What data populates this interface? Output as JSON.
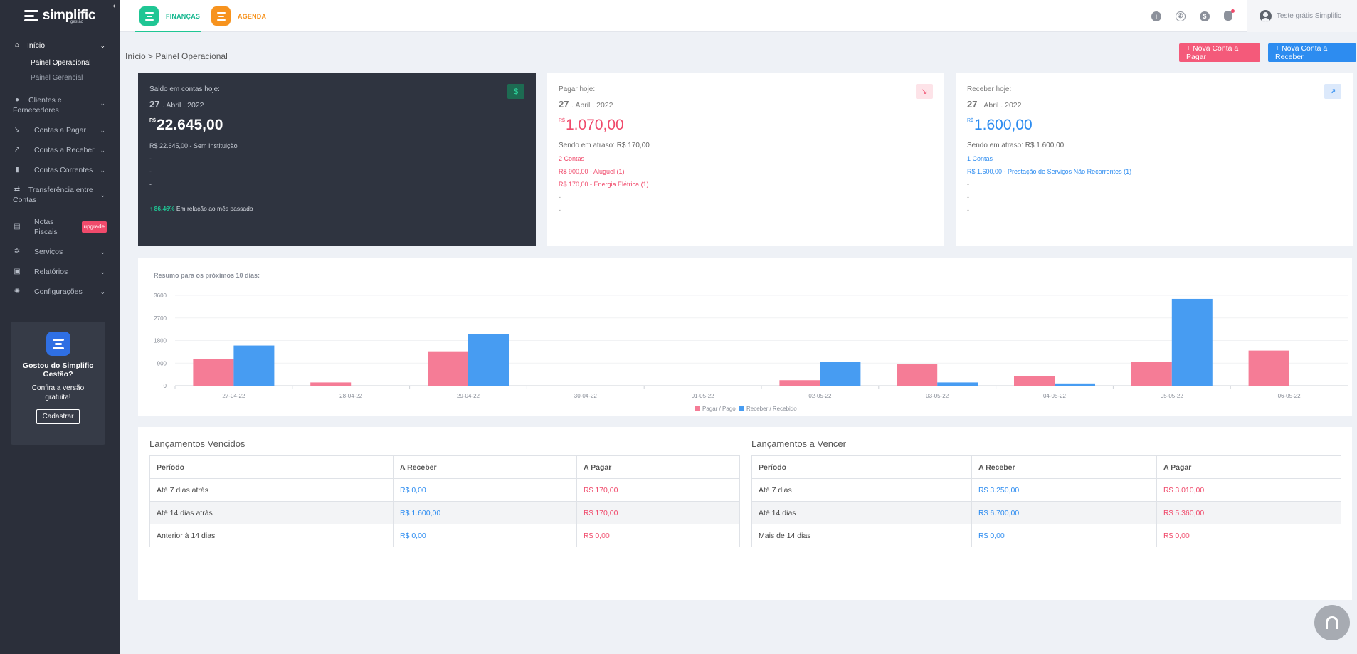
{
  "brand": {
    "name": "simplific",
    "sub": "gestão"
  },
  "sidebar": {
    "items": [
      {
        "label": "Início",
        "icon": "home-icon"
      },
      {
        "label": "Painel Operacional"
      },
      {
        "label": "Painel Gerencial"
      },
      {
        "label": "Clientes e Fornecedores",
        "icon": "users-icon"
      },
      {
        "label": "Contas a Pagar",
        "icon": "trend-down-icon"
      },
      {
        "label": "Contas a Receber",
        "icon": "trend-up-icon"
      },
      {
        "label": "Contas Correntes",
        "icon": "bar-chart-icon"
      },
      {
        "label": "Transferência entre Contas",
        "icon": "transfer-icon"
      },
      {
        "label": "Notas Fiscais",
        "icon": "document-icon",
        "badge": "upgrade"
      },
      {
        "label": "Serviços",
        "icon": "gear-icon"
      },
      {
        "label": "Relatórios",
        "icon": "report-icon"
      },
      {
        "label": "Configurações",
        "icon": "settings-icon"
      }
    ],
    "promo": {
      "title": "Gostou do Simplific Gestão?",
      "text": "Confira a versão gratuita!",
      "button": "Cadastrar"
    }
  },
  "topbar": {
    "modules": [
      {
        "label": "FINANÇAS",
        "color": "#1fc694"
      },
      {
        "label": "AGENDA",
        "color": "#f7931e"
      }
    ],
    "user": "Teste grátis Simplific"
  },
  "breadcrumb": "Início > Painel Operacional",
  "actions": {
    "new_payable": "+ Nova Conta a Pagar",
    "new_receivable": "+ Nova Conta a Receber"
  },
  "cards": {
    "balance": {
      "label": "Saldo em contas hoje:",
      "day": "27",
      "month_year": ". Abril . 2022",
      "currency": "R$",
      "amount": "22.645,00",
      "lines": [
        "R$ 22.645,00 - Sem Instituição",
        "-",
        "-",
        "-"
      ],
      "trend_value": "86.46%",
      "trend_text": "Em relação ao mês passado"
    },
    "pay": {
      "label": "Pagar hoje:",
      "day": "27",
      "month_year": ". Abril . 2022",
      "currency": "R$",
      "amount": "1.070,00",
      "overdue": "Sendo em atraso: R$ 170,00",
      "count": "2 Contas",
      "lines": [
        "R$ 900,00 - Aluguel (1)",
        "R$ 170,00 - Energia Elétrica (1)",
        "-",
        "-"
      ]
    },
    "receive": {
      "label": "Receber hoje:",
      "day": "27",
      "month_year": ". Abril . 2022",
      "currency": "R$",
      "amount": "1.600,00",
      "overdue": "Sendo em atraso: R$ 1.600,00",
      "count": "1 Contas",
      "lines": [
        "R$ 1.600,00 - Prestação de Serviços Não Recorrentes (1)",
        "-",
        "-",
        "-"
      ]
    }
  },
  "chart_title": "Resumo para os próximos 10 dias:",
  "chart_data": {
    "type": "bar",
    "categories": [
      "27-04-22",
      "28-04-22",
      "29-04-22",
      "30-04-22",
      "01-05-22",
      "02-05-22",
      "03-05-22",
      "04-05-22",
      "05-05-22",
      "06-05-22"
    ],
    "series": [
      {
        "name": "Pagar / Pago",
        "color": "#f57c96",
        "values": [
          1070,
          130,
          1370,
          0,
          0,
          220,
          850,
          380,
          960,
          1400
        ]
      },
      {
        "name": "Receber / Recebido",
        "color": "#479cf2",
        "values": [
          1600,
          0,
          2060,
          0,
          0,
          960,
          130,
          90,
          3460,
          0
        ]
      }
    ],
    "ylim": [
      0,
      3600
    ],
    "yticks": [
      0,
      900,
      1800,
      2700,
      3600
    ],
    "legend": "bottom"
  },
  "overdue_table": {
    "title": "Lançamentos Vencidos",
    "headers": [
      "Período",
      "A Receber",
      "A Pagar"
    ],
    "rows": [
      [
        "Até 7 dias atrás",
        "R$ 0,00",
        "R$ 170,00"
      ],
      [
        "Até 14 dias atrás",
        "R$ 1.600,00",
        "R$ 170,00"
      ],
      [
        "Anterior à 14 dias",
        "R$ 0,00",
        "R$ 0,00"
      ]
    ]
  },
  "upcoming_table": {
    "title": "Lançamentos a Vencer",
    "headers": [
      "Período",
      "A Receber",
      "A Pagar"
    ],
    "rows": [
      [
        "Até 7 dias",
        "R$ 3.250,00",
        "R$ 3.010,00"
      ],
      [
        "Até 14 dias",
        "R$ 6.700,00",
        "R$ 5.360,00"
      ],
      [
        "Mais de 14 dias",
        "R$ 0,00",
        "R$ 0,00"
      ]
    ]
  }
}
